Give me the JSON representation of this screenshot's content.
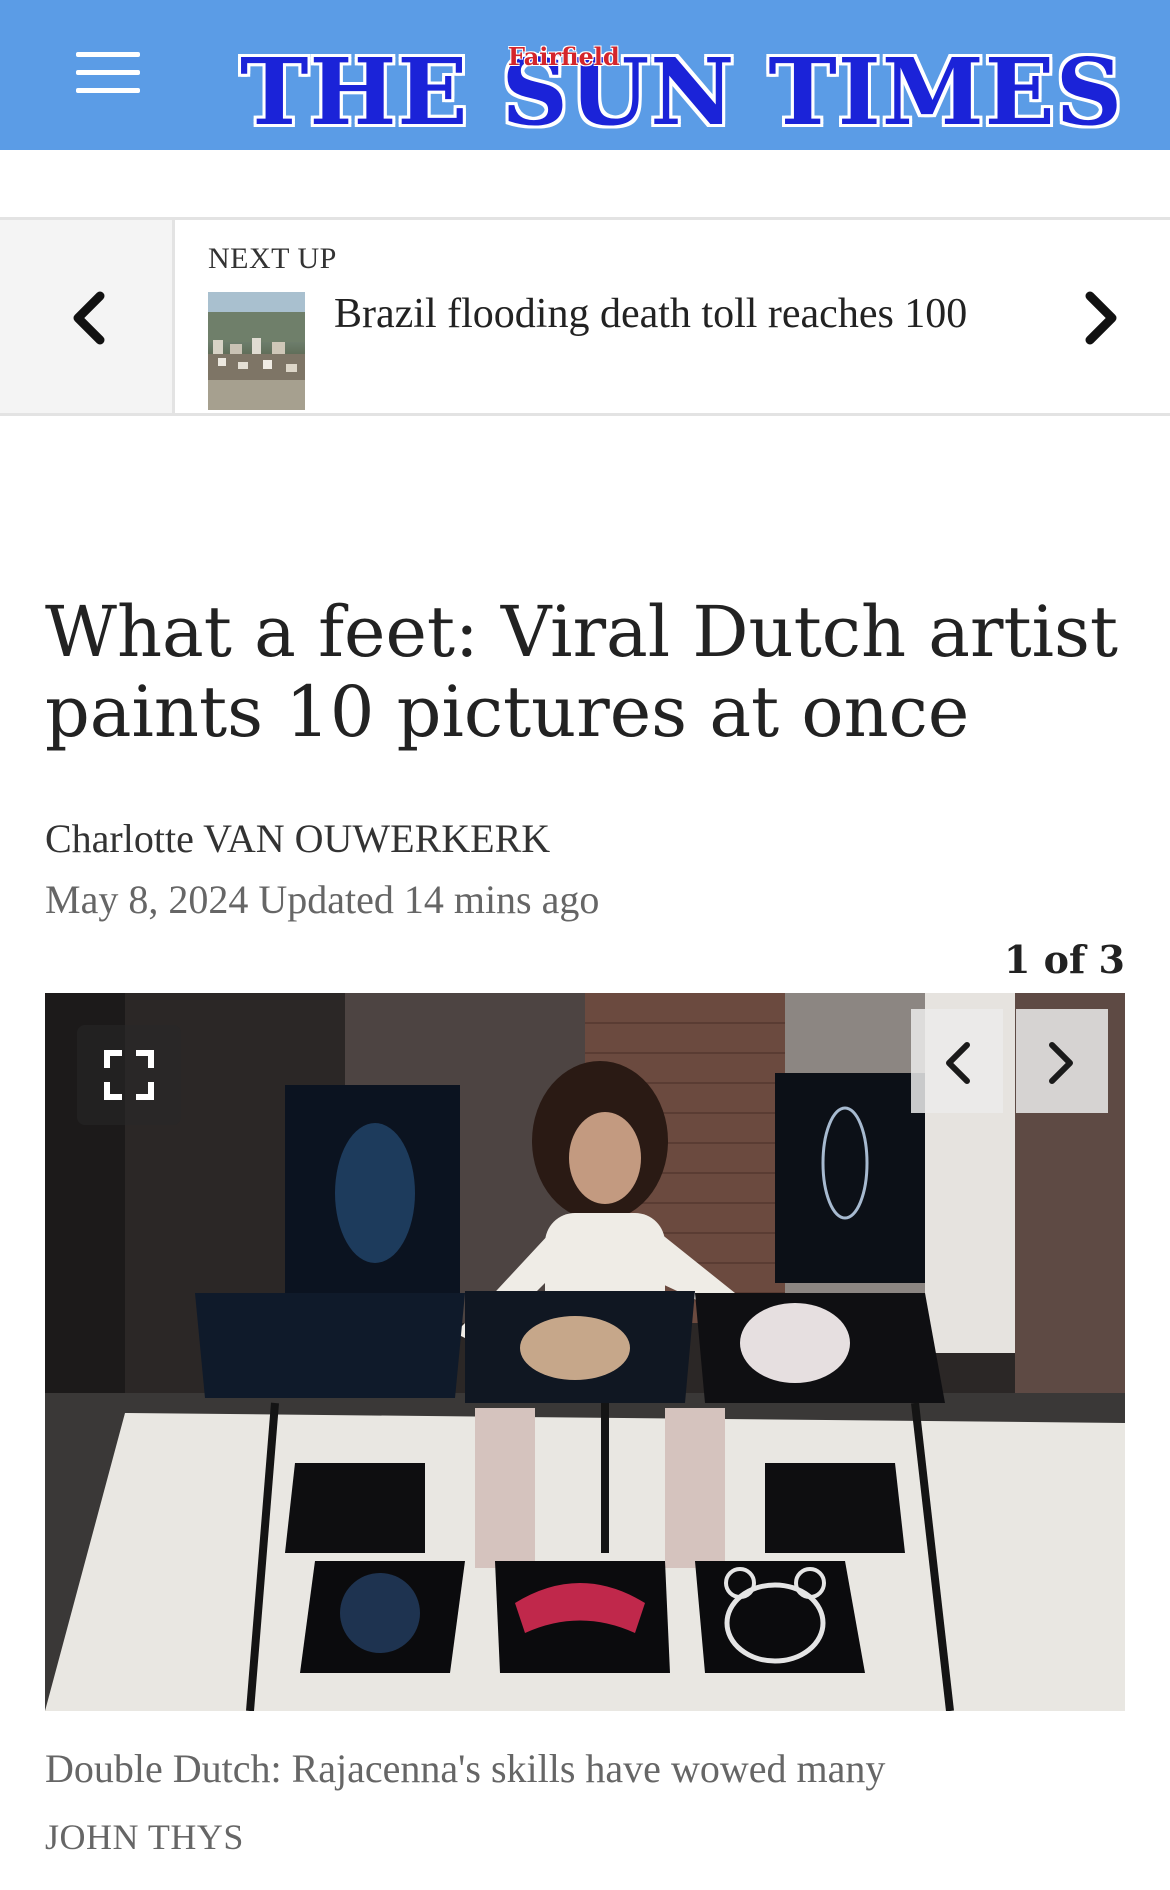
{
  "header": {
    "logo_main": "THE SUN TIMES",
    "logo_sub": "Fairfield",
    "brand_color": "#5b9ce6",
    "menu_icon": "hamburger-menu-icon"
  },
  "next_up": {
    "label": "NEXT UP",
    "title": "Brazil flooding death toll reaches 100",
    "prev_icon": "chevron-left-icon",
    "next_icon": "chevron-right-icon"
  },
  "article": {
    "headline": "What a feet: Viral Dutch artist paints 10 pictures at once",
    "author": "Charlotte VAN OUWERKERK",
    "date": "May 8, 2024 Updated 14 mins ago"
  },
  "gallery": {
    "counter": "1 of 3",
    "caption": "Double Dutch: Rajacenna's skills have wowed many",
    "credit": "JOHN THYS",
    "expand_icon": "fullscreen-icon",
    "prev_icon": "chevron-left-icon",
    "next_icon": "chevron-right-icon"
  }
}
